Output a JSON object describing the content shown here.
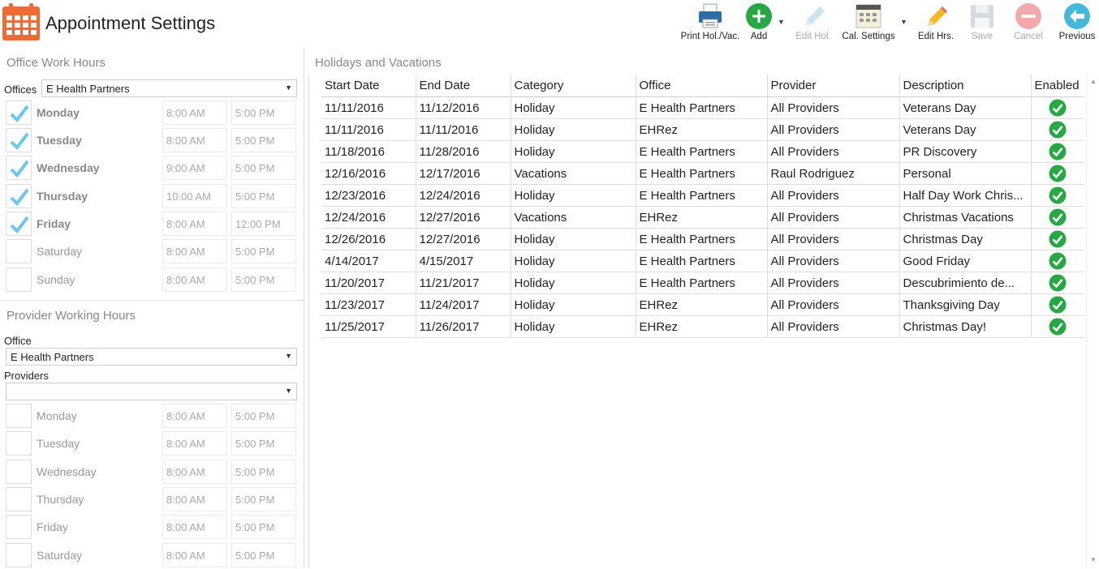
{
  "app": {
    "title": "Appointment Settings"
  },
  "toolbar": {
    "print": "Print Hol./Vac.",
    "add": "Add",
    "edit_hol": "Edit Hol.",
    "cal_settings": "Cal. Settings",
    "edit_hrs": "Edit Hrs.",
    "save": "Save",
    "cancel": "Cancel",
    "previous": "Previous"
  },
  "office_hours": {
    "title": "Office Work Hours",
    "offices_label": "Offices",
    "office_value": "E Health Partners",
    "days": [
      {
        "name": "Monday",
        "checked": true,
        "start": "8:00 AM",
        "end": "5:00 PM"
      },
      {
        "name": "Tuesday",
        "checked": true,
        "start": "8:00 AM",
        "end": "5:00 PM"
      },
      {
        "name": "Wednesday",
        "checked": true,
        "start": "9:00 AM",
        "end": "5:00 PM"
      },
      {
        "name": "Thursday",
        "checked": true,
        "start": "10:00 AM",
        "end": "5:00 PM"
      },
      {
        "name": "Friday",
        "checked": true,
        "start": "8:00 AM",
        "end": "12:00 PM"
      },
      {
        "name": "Saturday",
        "checked": false,
        "start": "8:00 AM",
        "end": "5:00 PM"
      },
      {
        "name": "Sunday",
        "checked": false,
        "start": "8:00 AM",
        "end": "5:00 PM"
      }
    ]
  },
  "provider_hours": {
    "title": "Provider Working Hours",
    "office_label": "Office",
    "office_value": "E Health Partners",
    "providers_label": "Providers",
    "providers_value": "",
    "days": [
      {
        "name": "Monday",
        "start": "8:00 AM",
        "end": "5:00 PM"
      },
      {
        "name": "Tuesday",
        "start": "8:00 AM",
        "end": "5:00 PM"
      },
      {
        "name": "Wednesday",
        "start": "8:00 AM",
        "end": "5:00 PM"
      },
      {
        "name": "Thursday",
        "start": "8:00 AM",
        "end": "5:00 PM"
      },
      {
        "name": "Friday",
        "start": "8:00 AM",
        "end": "5:00 PM"
      },
      {
        "name": "Saturday",
        "start": "8:00 AM",
        "end": "5:00 PM"
      }
    ]
  },
  "holidays": {
    "title": "Holidays and Vacations",
    "columns": [
      "Start Date",
      "End Date",
      "Category",
      "Office",
      "Provider",
      "Description",
      "Enabled"
    ],
    "rows": [
      {
        "start": "11/11/2016",
        "end": "11/12/2016",
        "category": "Holiday",
        "office": "E Health Partners",
        "provider": "All Providers",
        "description": "Veterans Day"
      },
      {
        "start": "11/11/2016",
        "end": "11/11/2016",
        "category": "Holiday",
        "office": "EHRez",
        "provider": "All Providers",
        "description": "Veterans Day"
      },
      {
        "start": "11/18/2016",
        "end": "11/28/2016",
        "category": "Holiday",
        "office": "E Health Partners",
        "provider": "All Providers",
        "description": "PR Discovery"
      },
      {
        "start": "12/16/2016",
        "end": "12/17/2016",
        "category": "Vacations",
        "office": "E Health Partners",
        "provider": "Raul Rodriguez",
        "description": "Personal"
      },
      {
        "start": "12/23/2016",
        "end": "12/24/2016",
        "category": "Holiday",
        "office": "E Health Partners",
        "provider": "All Providers",
        "description": "Half Day Work Chris..."
      },
      {
        "start": "12/24/2016",
        "end": "12/27/2016",
        "category": "Vacations",
        "office": "EHRez",
        "provider": "All Providers",
        "description": "Christmas Vacations"
      },
      {
        "start": "12/26/2016",
        "end": "12/27/2016",
        "category": "Holiday",
        "office": "E Health Partners",
        "provider": "All Providers",
        "description": "Christmas Day"
      },
      {
        "start": "4/14/2017",
        "end": "4/15/2017",
        "category": "Holiday",
        "office": "E Health Partners",
        "provider": "All Providers",
        "description": "Good Friday"
      },
      {
        "start": "11/20/2017",
        "end": "11/21/2017",
        "category": "Holiday",
        "office": "E Health Partners",
        "provider": "All Providers",
        "description": "Descubrimiento de..."
      },
      {
        "start": "11/23/2017",
        "end": "11/24/2017",
        "category": "Holiday",
        "office": "EHRez",
        "provider": "All Providers",
        "description": "Thanksgiving Day"
      },
      {
        "start": "11/25/2017",
        "end": "11/26/2017",
        "category": "Holiday",
        "office": "EHRez",
        "provider": "All Providers",
        "description": "Christmas Day!"
      }
    ]
  },
  "colors": {
    "accent_orange": "#F06A35",
    "green_check": "#27A844",
    "checkbox_blue": "#6CC7EE"
  }
}
